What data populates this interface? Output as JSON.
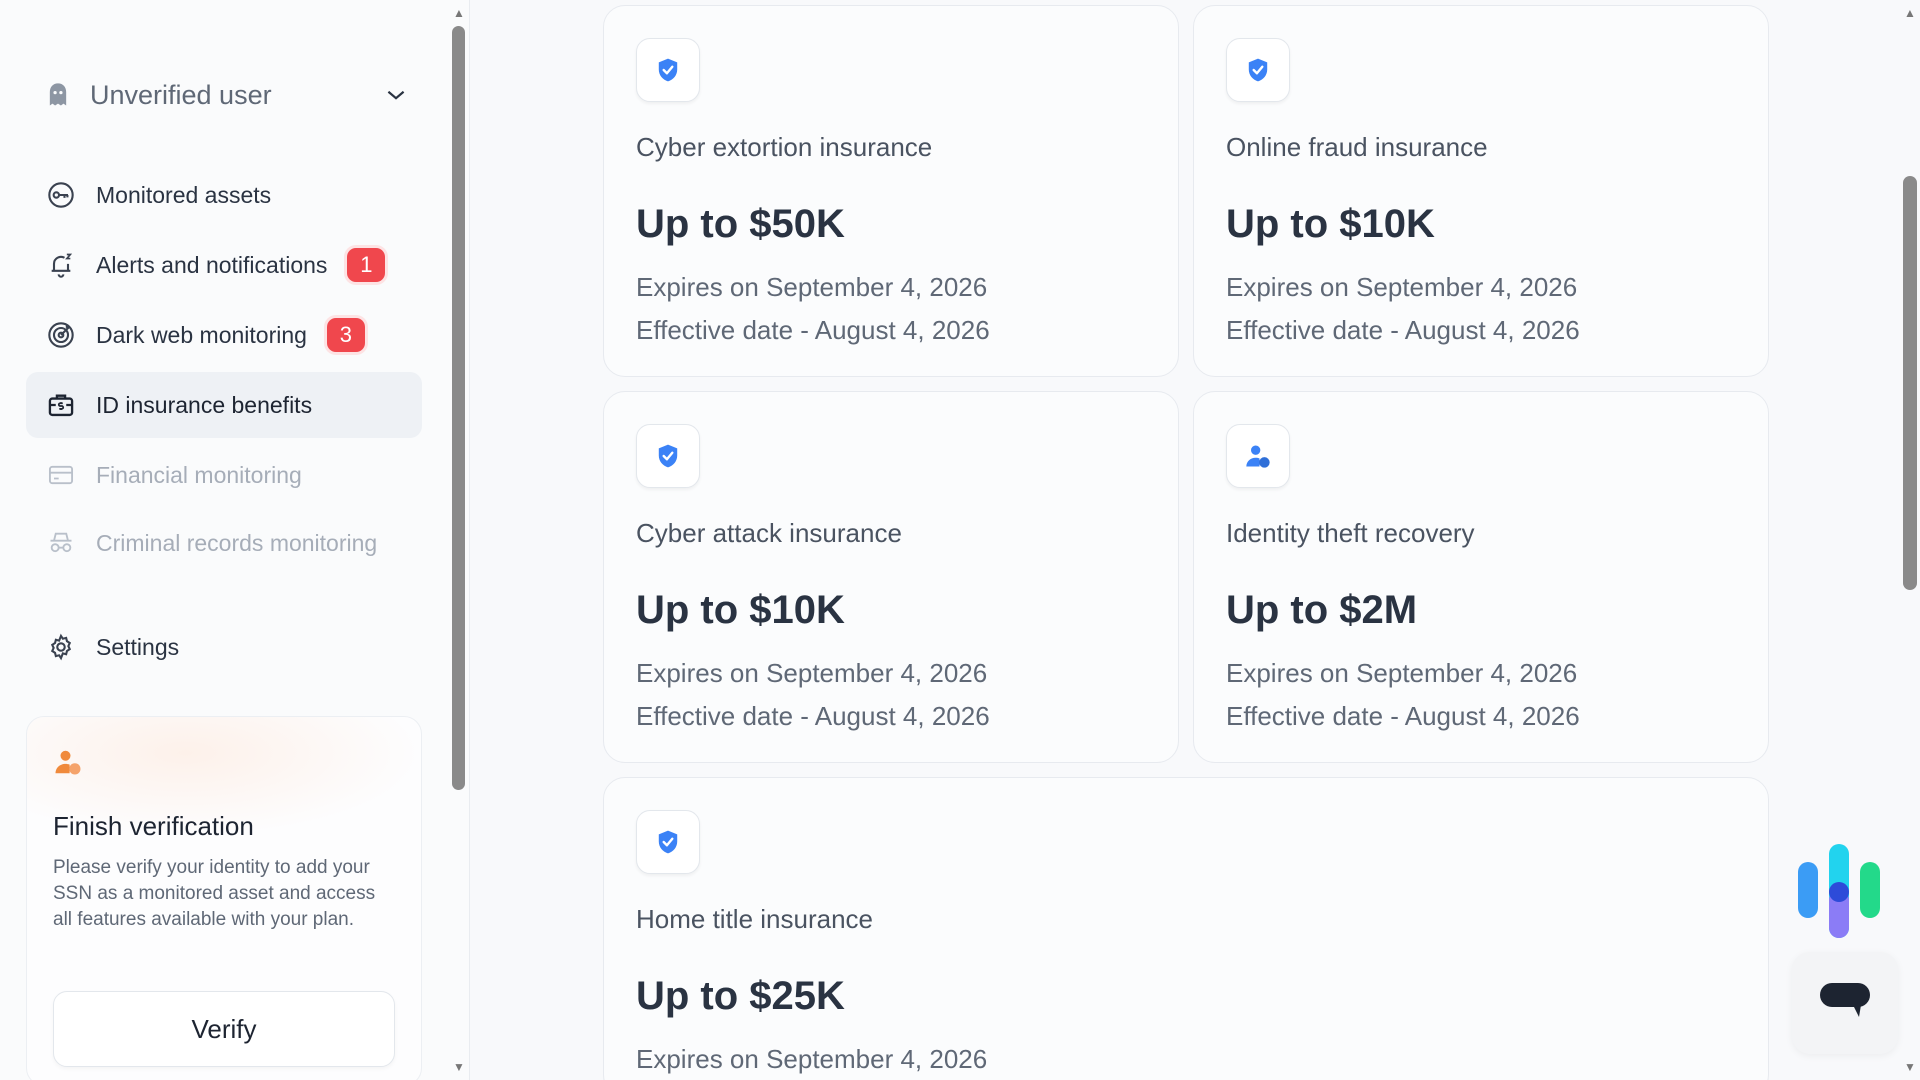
{
  "user": {
    "name": "Unverified user",
    "icon": "ghost-icon"
  },
  "nav": [
    {
      "label": "Monitored assets",
      "icon": "key-icon",
      "badge": null,
      "state": "normal"
    },
    {
      "label": "Alerts and notifications",
      "icon": "bell-icon",
      "badge": "1",
      "state": "normal"
    },
    {
      "label": "Dark web monitoring",
      "icon": "target-icon",
      "badge": "3",
      "state": "normal"
    },
    {
      "label": "ID insurance benefits",
      "icon": "briefcase-dollar-icon",
      "badge": null,
      "state": "active"
    },
    {
      "label": "Financial monitoring",
      "icon": "credit-card-icon",
      "badge": null,
      "state": "disabled"
    },
    {
      "label": "Criminal records monitoring",
      "icon": "spy-icon",
      "badge": null,
      "state": "disabled"
    },
    {
      "label": "Settings",
      "icon": "gear-icon",
      "badge": null,
      "state": "normal"
    }
  ],
  "verification": {
    "title": "Finish verification",
    "text": "Please verify your identity to add your SSN as a monitored asset and access all features available with your plan.",
    "button": "Verify"
  },
  "cards": [
    {
      "title": "Cyber extortion insurance",
      "amount": "Up to $50K",
      "expires": "Expires on September 4, 2026",
      "effective": "Effective date - August 4, 2026",
      "icon": "shield-check-icon"
    },
    {
      "title": "Online fraud insurance",
      "amount": "Up to $10K",
      "expires": "Expires on September 4, 2026",
      "effective": "Effective date - August 4, 2026",
      "icon": "shield-check-icon"
    },
    {
      "title": "Cyber attack insurance",
      "amount": "Up to $10K",
      "expires": "Expires on September 4, 2026",
      "effective": "Effective date - August 4, 2026",
      "icon": "shield-check-icon"
    },
    {
      "title": "Identity theft recovery",
      "amount": "Up to $2M",
      "expires": "Expires on September 4, 2026",
      "effective": "Effective date - August 4, 2026",
      "icon": "user-shield-icon"
    },
    {
      "title": "Home title insurance",
      "amount": "Up to $25K",
      "expires": "Expires on September 4, 2026",
      "effective": "",
      "icon": "shield-check-icon"
    }
  ],
  "colors": {
    "accent": "#3b82f6",
    "badge": "#f0474d",
    "verify_icon": "#f08a3c"
  }
}
